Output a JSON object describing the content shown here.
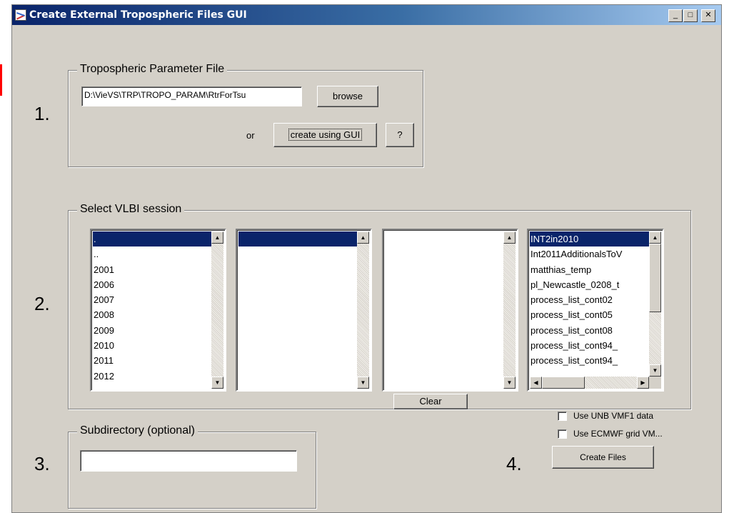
{
  "window": {
    "title": "Create External Tropospheric Files GUI",
    "controls": {
      "minimize": "_",
      "maximize": "□",
      "close": "✕"
    }
  },
  "step1": {
    "number": "1.",
    "group_title": "Tropospheric Parameter File",
    "file_path": "D:\\VieVS\\TRP\\TROPO_PARAM\\RtrForTsu",
    "browse_label": "browse",
    "or_label": "or",
    "create_gui_label": "create using GUI",
    "help_label": "?"
  },
  "step2": {
    "number": "2.",
    "group_title": "Select VLBI session",
    "list1": {
      "items": [
        ".",
        "..",
        "2001",
        "2006",
        "2007",
        "2008",
        "2009",
        "2010",
        "2011",
        "2012"
      ],
      "selected_index": 0
    },
    "list2": {
      "items": [
        ""
      ],
      "selected_index": 0
    },
    "list3": {
      "items": []
    },
    "list4": {
      "items": [
        "INT2in2010",
        "Int2011AdditionalsToV",
        "matthias_temp",
        "pl_Newcastle_0208_t",
        "process_list_cont02",
        "process_list_cont05",
        "process_list_cont08",
        "process_list_cont94_",
        "process_list_cont94_"
      ],
      "selected_index": 0
    },
    "clear_label": "Clear"
  },
  "step3": {
    "number": "3.",
    "group_title": "Subdirectory (optional)",
    "subdirectory_value": ""
  },
  "step4": {
    "number": "4.",
    "use_unb_label": "Use UNB VMF1 data",
    "use_unb_checked": false,
    "use_ecmwf_label": "Use ECMWF grid VM...",
    "use_ecmwf_checked": false,
    "create_files_label": "Create Files"
  },
  "colors": {
    "selection": "#0a246a",
    "window_bg": "#d4d0c8",
    "annotation_red": "#ff0000"
  }
}
